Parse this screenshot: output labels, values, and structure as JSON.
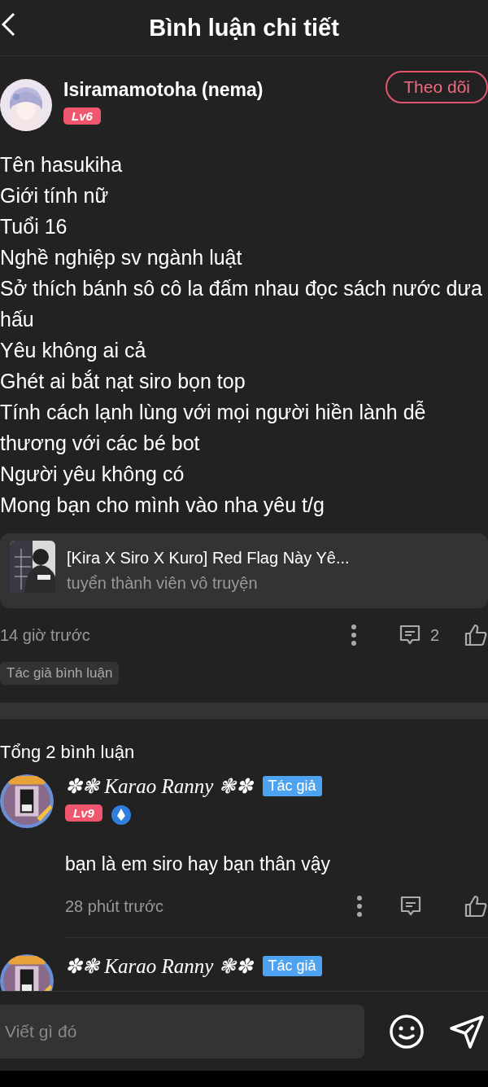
{
  "header": {
    "title": "Bình luận chi tiết"
  },
  "post": {
    "author": "Isiramamotoha (nema)",
    "level": "Lv6",
    "follow_button": "Theo dõi",
    "lines": [
      "Tên hasukiha",
      "Giới tính nữ",
      "Tuổi 16",
      "Nghề nghiệp sv ngành luật",
      "Sở thích bánh sô cô la đấm nhau đọc sách nước dưa hấu",
      "Yêu không ai cả",
      "Ghét ai bắt nạt siro bọn top",
      "Tính cách lạnh lùng với mọi người hiền lành dễ thương với các bé bot",
      "Người yêu không có",
      "Mong bạn cho mình vào nha yêu t/g"
    ],
    "story": {
      "title": "[Kira X Siro X Kuro] Red Flag Này Yê...",
      "subtitle": "tuyển thành viên vô truyện"
    },
    "time": "14 giờ trước",
    "reply_count": "2",
    "tag": "Tác giả bình luận"
  },
  "comments_total": "Tổng 2 bình luận",
  "comments": [
    {
      "author": "✽❃ Karao Ranny ❃✽",
      "badge": "Tác giả",
      "level": "Lv9",
      "text": "bạn là em siro hay bạn thân vậy",
      "time": "28 phút trước"
    },
    {
      "author": "✽❃ Karao Ranny ❃✽",
      "badge": "Tác giả"
    }
  ],
  "input": {
    "placeholder": "Viết gì đó"
  }
}
